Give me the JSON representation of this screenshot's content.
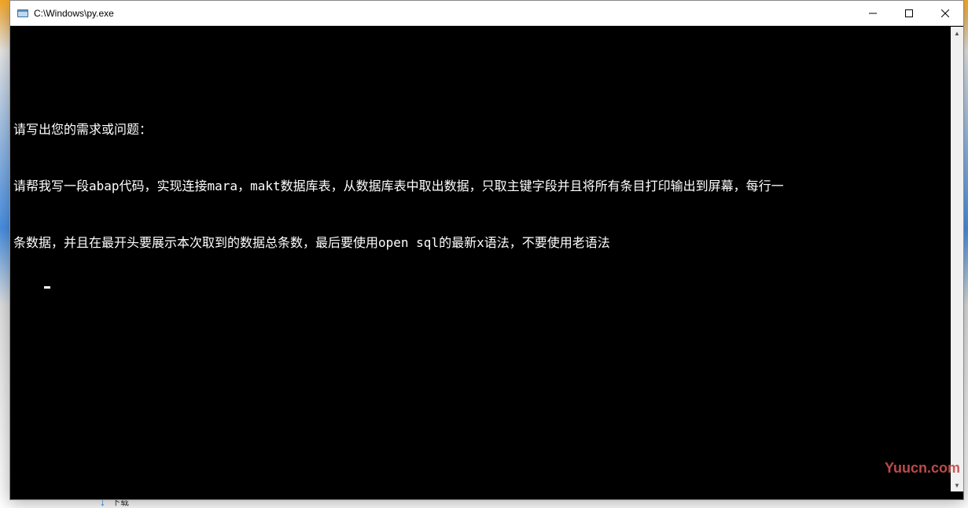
{
  "window": {
    "title": "C:\\Windows\\py.exe"
  },
  "console": {
    "prompt": "请写出您的需求或问题：",
    "input_line1": "请帮我写一段abap代码，实现连接mara，makt数据库表，从数据库表中取出数据，只取主键字段并且将所有条目打印输出到屏幕，每行一",
    "input_line2": "条数据，并且在最开头要展示本次取到的数据总条数，最后要使用open sql的最新x语法，不要使用老语法"
  },
  "watermark": "Yuucn.com",
  "desktop": {
    "item": "下载"
  }
}
